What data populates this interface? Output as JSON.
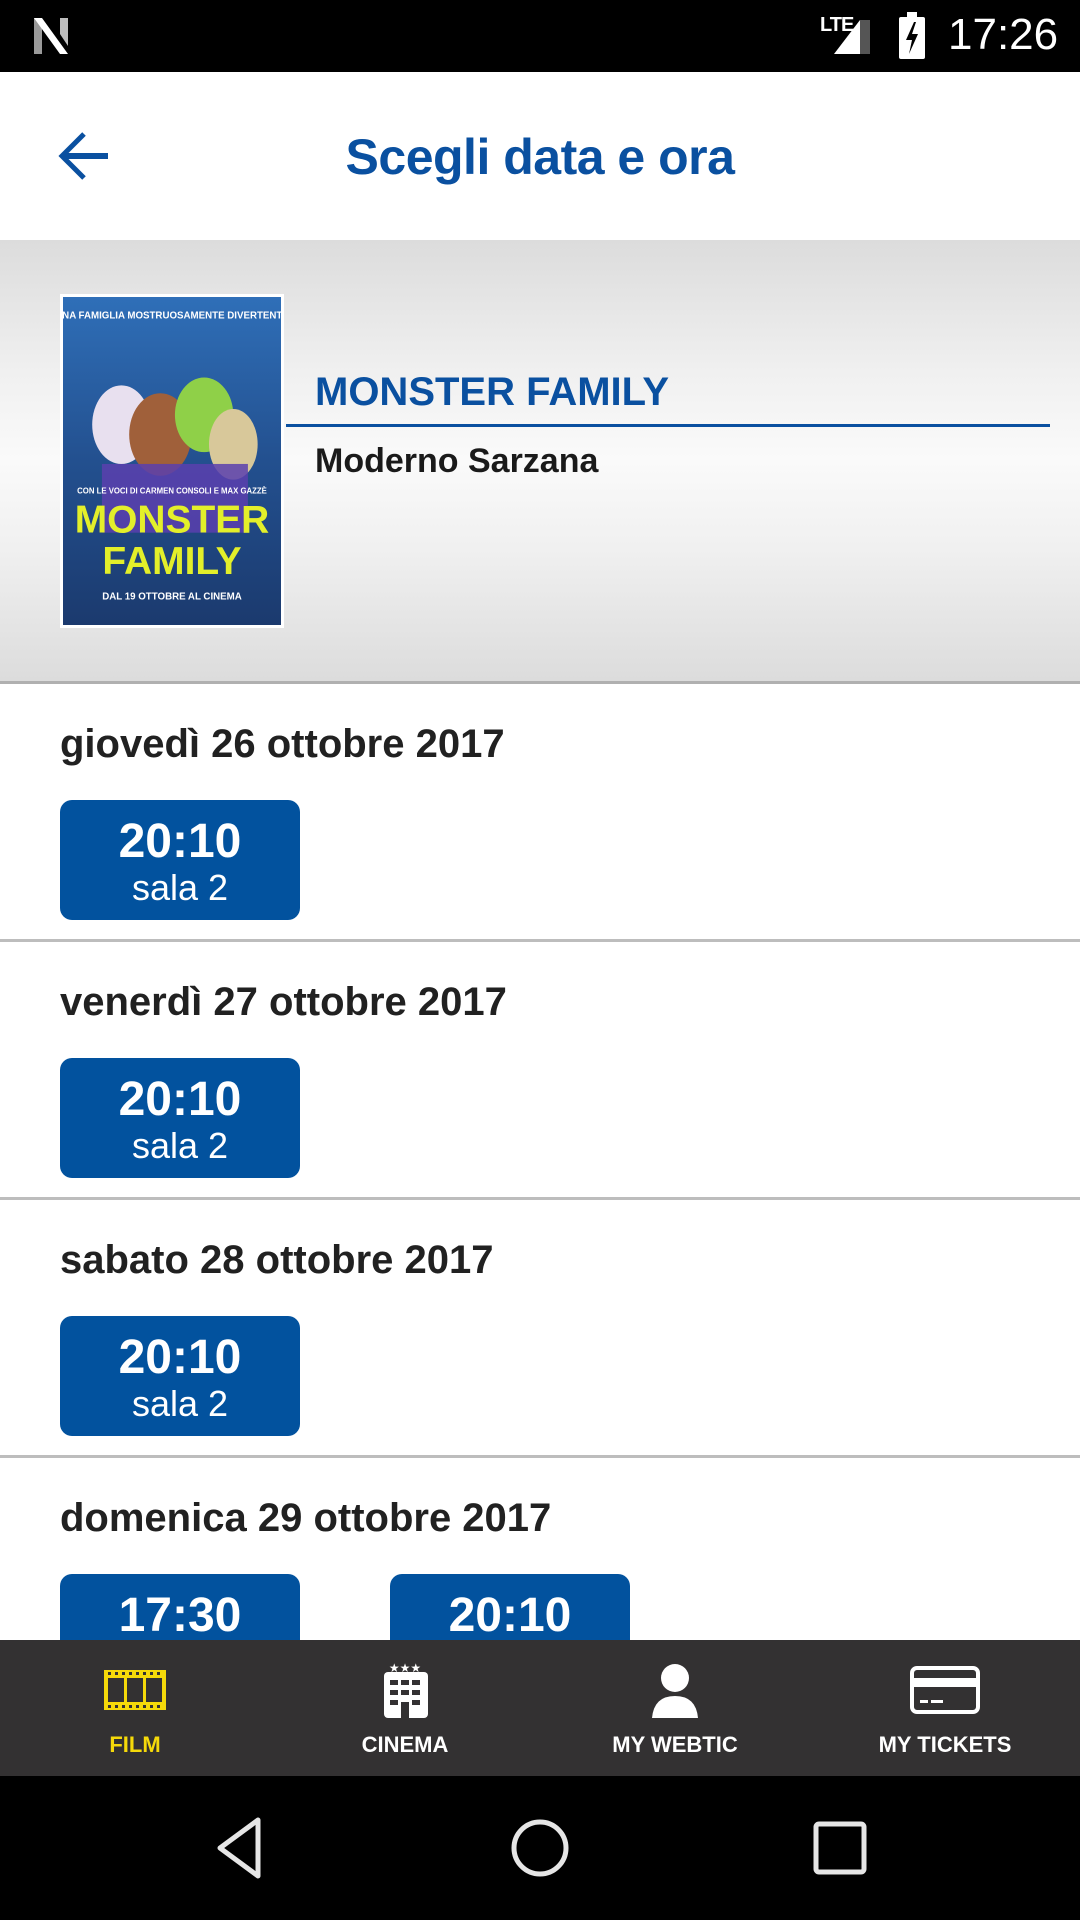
{
  "status_bar": {
    "network": "LTE",
    "time": "17:26",
    "icons": [
      "android-n-logo-icon",
      "lte-signal-icon",
      "battery-charging-icon"
    ]
  },
  "app_bar": {
    "title": "Scegli data e ora",
    "back_icon": "arrow-left-icon"
  },
  "movie": {
    "title": "MONSTER FAMILY",
    "cinema": "Moderno Sarzana",
    "poster": {
      "tagline": "UNA FAMIGLIA MOSTRUOSAMENTE DIVERTENTE",
      "voices": "CON LE VOCI DI CARMEN CONSOLI E MAX GAZZÈ",
      "title_line1": "MONSTER",
      "title_line2": "FAMILY",
      "release": "DAL 19 OTTOBRE AL CINEMA"
    }
  },
  "days": [
    {
      "label": "giovedì 26 ottobre 2017",
      "showtimes": [
        {
          "time": "20:10",
          "room": "sala 2"
        }
      ]
    },
    {
      "label": "venerdì 27 ottobre 2017",
      "showtimes": [
        {
          "time": "20:10",
          "room": "sala 2"
        }
      ]
    },
    {
      "label": "sabato 28 ottobre 2017",
      "showtimes": [
        {
          "time": "20:10",
          "room": "sala 2"
        }
      ]
    },
    {
      "label": "domenica 29 ottobre 2017",
      "showtimes": [
        {
          "time": "17:30",
          "room": ""
        },
        {
          "time": "20:10",
          "room": ""
        }
      ]
    }
  ],
  "bottom_nav": {
    "active": "film",
    "items": [
      {
        "id": "film",
        "label": "FILM",
        "icon": "film-strip-icon"
      },
      {
        "id": "cinema",
        "label": "CINEMA",
        "icon": "cinema-building-icon"
      },
      {
        "id": "my-webtic",
        "label": "MY WEBTIC",
        "icon": "user-icon"
      },
      {
        "id": "my-tickets",
        "label": "MY TICKETS",
        "icon": "credit-card-icon"
      }
    ]
  },
  "colors": {
    "primary": "#0a50a0",
    "button": "#02529e",
    "nav_bg": "#333132",
    "nav_active": "#f5d90a"
  }
}
